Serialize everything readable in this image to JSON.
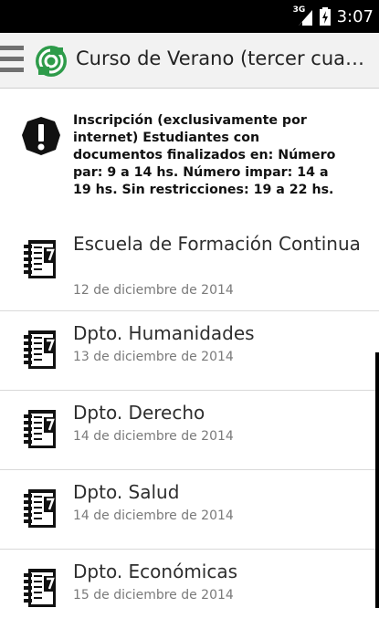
{
  "status_bar": {
    "network_label": "3G",
    "time": "3:07",
    "icons": [
      "signal-3g-icon",
      "battery-icon"
    ]
  },
  "action_bar": {
    "title": "Curso de Verano (tercer cuatrimestre)",
    "icons": [
      "drawer-menu-icon",
      "app-logo-icon"
    ],
    "colors": {
      "logo": "#2e9b4a"
    }
  },
  "notice": {
    "icon": "exclamation-icon",
    "text": "Inscripción (exclusivamente por internet) Estudiantes con documentos finalizados en: Número par: 9 a 14 hs. Número impar: 14 a 19 hs. Sin restricciones: 19 a 22 hs."
  },
  "events": [
    {
      "title": "Escuela de Formación Continua",
      "date": "12 de diciembre de 2014",
      "icon": "calendar-icon"
    },
    {
      "title": "Dpto. Humanidades",
      "date": "13 de diciembre de 2014",
      "icon": "calendar-icon"
    },
    {
      "title": "Dpto. Derecho",
      "date": "14 de diciembre de 2014",
      "icon": "calendar-icon"
    },
    {
      "title": "Dpto. Salud",
      "date": "14 de diciembre de 2014",
      "icon": "calendar-icon"
    },
    {
      "title": "Dpto. Económicas",
      "date": "15 de diciembre de 2014",
      "icon": "calendar-icon"
    }
  ]
}
